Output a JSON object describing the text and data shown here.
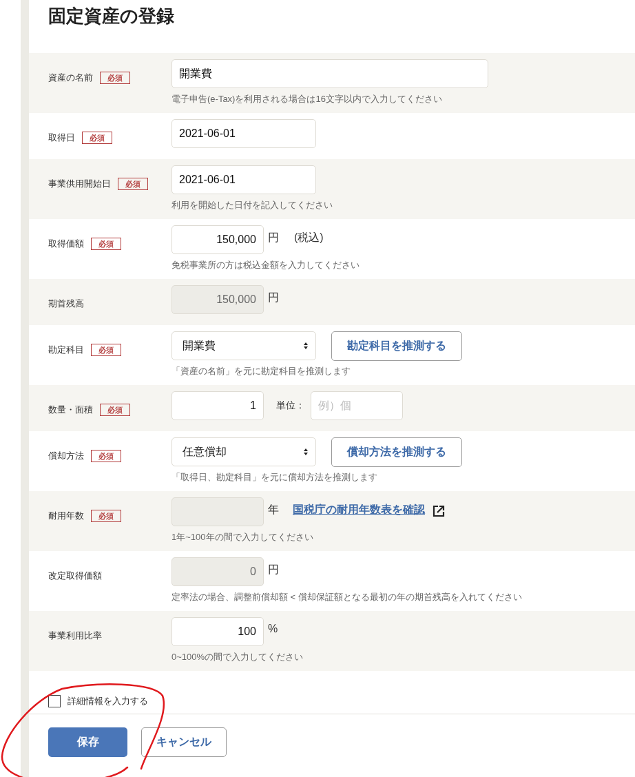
{
  "title": "固定資産の登録",
  "rows": [
    {
      "label": "資産の名前",
      "badge": "必須",
      "controls": [
        {
          "kind": "text",
          "value": "開業費"
        }
      ],
      "hint": "電子申告(e-Tax)を利用される場合は16文字以内で入力してください"
    },
    {
      "label": "取得日",
      "badge": "必須",
      "controls": [
        {
          "kind": "date",
          "value": "2021-06-01"
        }
      ]
    },
    {
      "label": "事業供用開始日",
      "badge": "必須",
      "controls": [
        {
          "kind": "date",
          "value": "2021-06-01"
        }
      ],
      "hint": "利用を開始した日付を記入してください"
    },
    {
      "label": "取得価額",
      "badge": "必須",
      "controls": [
        {
          "kind": "number",
          "value": "150,000",
          "disabled": false
        },
        {
          "kind": "unit",
          "text": "円"
        },
        {
          "kind": "note",
          "text": "(税込)"
        }
      ],
      "hint": "免税事業所の方は税込金額を入力してください"
    },
    {
      "label": "期首残高",
      "controls": [
        {
          "kind": "number",
          "value": "150,000",
          "disabled": true
        },
        {
          "kind": "unit",
          "text": "円"
        }
      ]
    },
    {
      "label": "勘定科目",
      "badge": "必須",
      "controls": [
        {
          "kind": "select",
          "value": "開業費"
        },
        {
          "kind": "button",
          "text": "勘定科目を推測する"
        }
      ],
      "hint": "「資産の名前」を元に勘定科目を推測します"
    },
    {
      "label": "数量・面積",
      "badge": "必須",
      "controls": [
        {
          "kind": "number",
          "value": "1",
          "disabled": false
        },
        {
          "kind": "label",
          "text": "単位："
        },
        {
          "kind": "placeholder",
          "placeholder": "例）個"
        }
      ]
    },
    {
      "label": "償却方法",
      "badge": "必須",
      "controls": [
        {
          "kind": "select",
          "value": "任意償却"
        },
        {
          "kind": "button",
          "text": "償却方法を推測する"
        }
      ],
      "hint": "「取得日、勘定科目」を元に償却方法を推測します"
    },
    {
      "label": "耐用年数",
      "badge": "必須",
      "controls": [
        {
          "kind": "number",
          "disabled": true
        },
        {
          "kind": "unit",
          "text": "年"
        },
        {
          "kind": "link",
          "text": "国税庁の耐用年数表を確認"
        }
      ],
      "hint": "1年~100年の間で入力してください"
    },
    {
      "label": "改定取得価額",
      "controls": [
        {
          "kind": "number",
          "value": "0",
          "disabled": true
        },
        {
          "kind": "unit",
          "text": "円"
        }
      ],
      "hint": "定率法の場合、調整前償却額 < 償却保証額となる最初の年の期首残高を入れてください"
    },
    {
      "label": "事業利用比率",
      "controls": [
        {
          "kind": "number",
          "value": "100",
          "disabled": false
        },
        {
          "kind": "unit",
          "text": "%"
        }
      ],
      "hint": "0~100%の間で入力してください"
    }
  ],
  "detail_toggle": {
    "label": "詳細情報を入力する",
    "checked": false
  },
  "buttons": [
    {
      "kind": "primary",
      "label": "保存"
    },
    {
      "kind": "secondary",
      "label": "キャンセル"
    }
  ]
}
